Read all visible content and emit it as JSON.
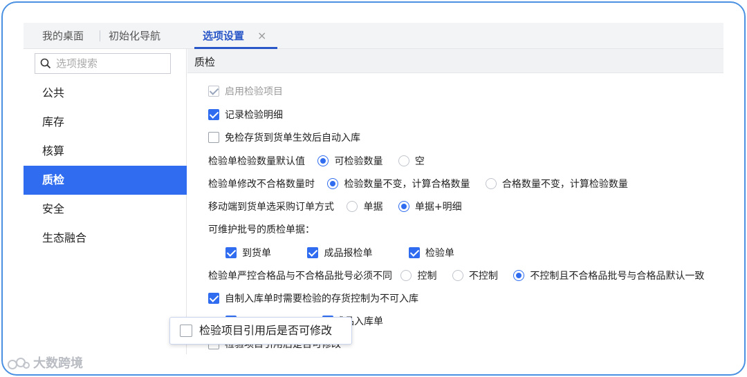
{
  "tabs": {
    "desktop": "我的桌面",
    "init_nav": "初始化导航",
    "options": "选项设置",
    "close": "×"
  },
  "search": {
    "placeholder": "选项搜索"
  },
  "sidebar": {
    "items": [
      {
        "label": "公共"
      },
      {
        "label": "库存"
      },
      {
        "label": "核算"
      },
      {
        "label": "质检"
      },
      {
        "label": "安全"
      },
      {
        "label": "生态融合"
      }
    ],
    "active": "质检"
  },
  "section": {
    "title": "质检"
  },
  "options": {
    "enable_inspection_items": {
      "label": "启用检验项目",
      "checked": true,
      "disabled": true
    },
    "record_inspection_detail": {
      "label": "记录检验明细",
      "checked": true
    },
    "auto_stock_in": {
      "label": "免检存货到货单生效后自动入库",
      "checked": false
    },
    "default_qty": {
      "label": "检验单检验数量默认值",
      "options": [
        "可检验数量",
        "空"
      ],
      "selected": "可检验数量"
    },
    "modify_unqualified": {
      "label": "检验单修改不合格数量时",
      "options": [
        "检验数量不变，计算合格数量",
        "合格数量不变，计算检验数量"
      ],
      "selected": "检验数量不变，计算合格数量"
    },
    "mobile_po_mode": {
      "label": "移动端到货单选采购订单方式",
      "options": [
        "单据",
        "单据+明细"
      ],
      "selected": "单据+明细"
    },
    "batch_docs": {
      "label": "可维护批号的质检单据：",
      "items": [
        {
          "label": "到货单",
          "checked": true
        },
        {
          "label": "成品报检单",
          "checked": true
        },
        {
          "label": "检验单",
          "checked": true
        }
      ]
    },
    "batch_control": {
      "label": "检验单严控合格品与不合格品批号必须不同",
      "options": [
        "控制",
        "不控制",
        "不控制且不合格品批号与合格品默认一致"
      ],
      "selected": "不控制且不合格品批号与合格品默认一致"
    },
    "self_made_control": {
      "label": "自制入库单时需要检验的存货控制为不可入库",
      "checked": true
    },
    "partial_row": {
      "label": "成品入库单"
    },
    "cut_row": {
      "label": "检验项目引用后是否可修改"
    }
  },
  "popup": {
    "label": "检验项目引用后是否可修改",
    "checked": false
  },
  "logo": {
    "text": "大数跨境"
  },
  "colors": {
    "accent": "#2f6cf0",
    "frame": "#4a90e2",
    "tab_active": "#2a57c7"
  }
}
